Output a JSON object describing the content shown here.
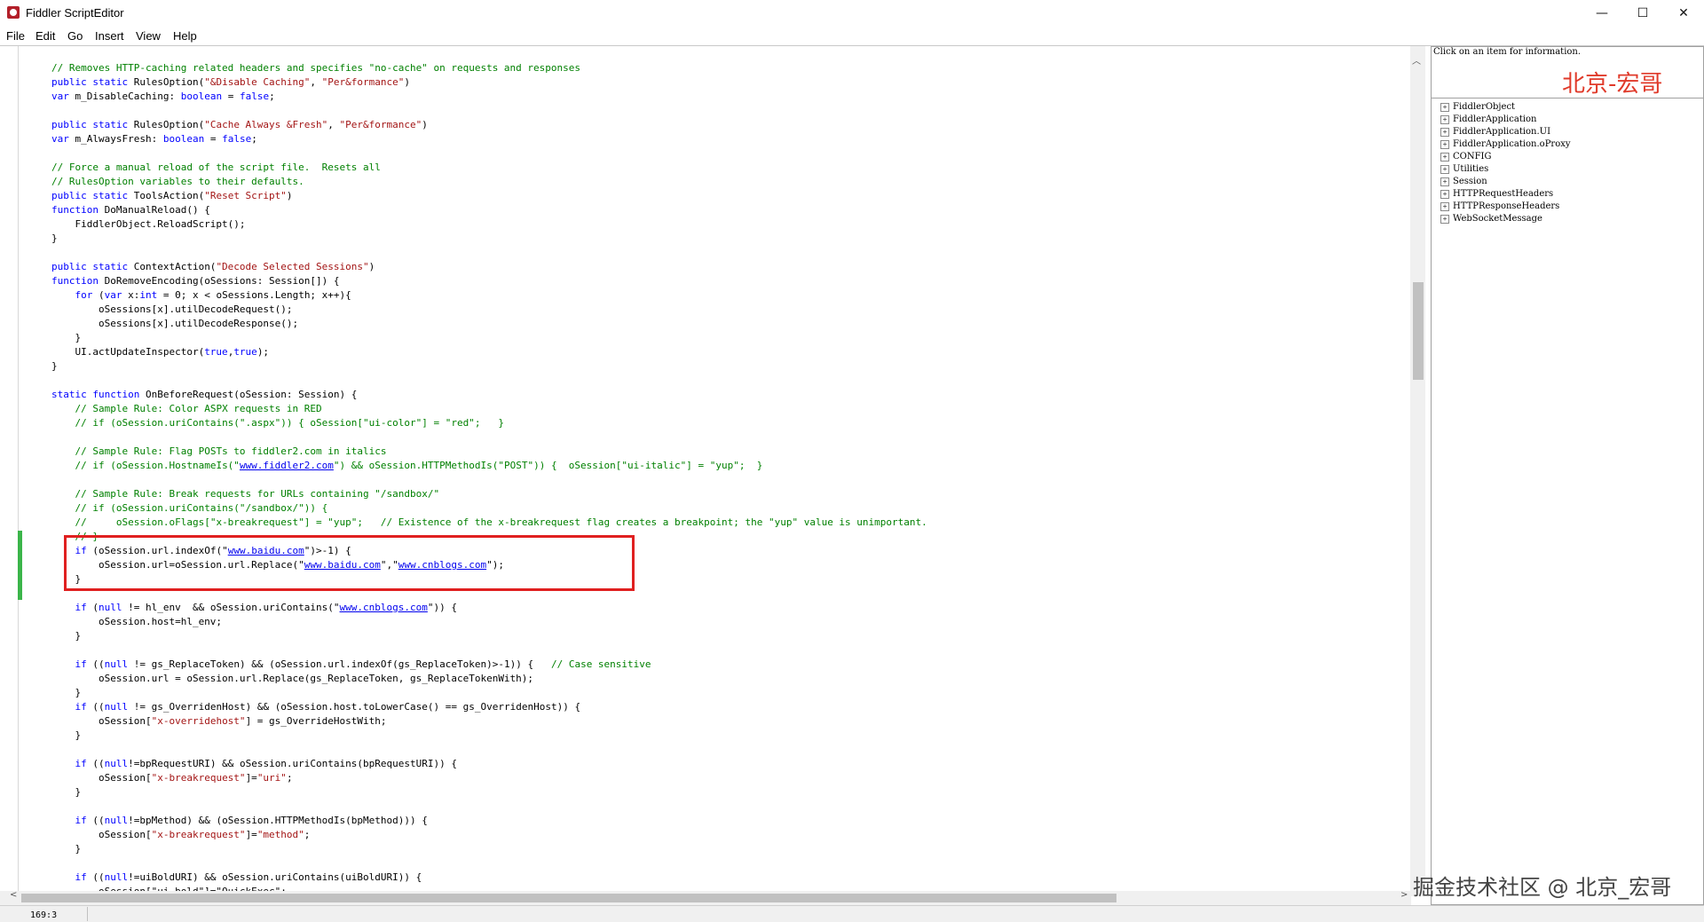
{
  "window": {
    "title": "Fiddler ScriptEditor",
    "min_glyph": "—",
    "max_glyph": "☐",
    "close_glyph": "✕"
  },
  "menu": [
    "File",
    "Edit",
    "Go",
    "Insert",
    "View",
    "Help"
  ],
  "code_lines": [
    [
      [
        "cm",
        "// Removes HTTP-caching related headers and specifies \"no-cache\" on requests and responses"
      ]
    ],
    [
      [
        "kw",
        "public static "
      ],
      [
        "t",
        "RulesOption("
      ],
      [
        "st",
        "\"&Disable Caching\""
      ],
      [
        "t",
        ", "
      ],
      [
        "st",
        "\"Per&formance\""
      ],
      [
        "t",
        ")"
      ]
    ],
    [
      [
        "kw",
        "var "
      ],
      [
        "t",
        "m_DisableCaching: "
      ],
      [
        "kw",
        "boolean"
      ],
      [
        "t",
        " = "
      ],
      [
        "kw",
        "false"
      ],
      [
        "t",
        ";"
      ]
    ],
    [],
    [
      [
        "kw",
        "public static "
      ],
      [
        "t",
        "RulesOption("
      ],
      [
        "st",
        "\"Cache Always &Fresh\""
      ],
      [
        "t",
        ", "
      ],
      [
        "st",
        "\"Per&formance\""
      ],
      [
        "t",
        ")"
      ]
    ],
    [
      [
        "kw",
        "var "
      ],
      [
        "t",
        "m_AlwaysFresh: "
      ],
      [
        "kw",
        "boolean"
      ],
      [
        "t",
        " = "
      ],
      [
        "kw",
        "false"
      ],
      [
        "t",
        ";"
      ]
    ],
    [],
    [
      [
        "cm",
        "// Force a manual reload of the script file.  Resets all"
      ]
    ],
    [
      [
        "cm",
        "// RulesOption variables to their defaults."
      ]
    ],
    [
      [
        "kw",
        "public static "
      ],
      [
        "t",
        "ToolsAction("
      ],
      [
        "st",
        "\"Reset Script\""
      ],
      [
        "t",
        ")"
      ]
    ],
    [
      [
        "kw",
        "function "
      ],
      [
        "t",
        "DoManualReload() {"
      ]
    ],
    [
      [
        "t",
        "    FiddlerObject.ReloadScript();"
      ]
    ],
    [
      [
        "t",
        "}"
      ]
    ],
    [],
    [
      [
        "kw",
        "public static "
      ],
      [
        "t",
        "ContextAction("
      ],
      [
        "st",
        "\"Decode Selected Sessions\""
      ],
      [
        "t",
        ")"
      ]
    ],
    [
      [
        "kw",
        "function "
      ],
      [
        "t",
        "DoRemoveEncoding(oSessions: Session[]) {"
      ]
    ],
    [
      [
        "t",
        "    "
      ],
      [
        "kw",
        "for "
      ],
      [
        "t",
        "("
      ],
      [
        "kw",
        "var "
      ],
      [
        "t",
        "x:"
      ],
      [
        "kw",
        "int"
      ],
      [
        "t",
        " = 0; x < oSessions.Length; x++){"
      ]
    ],
    [
      [
        "t",
        "        oSessions[x].utilDecodeRequest();"
      ]
    ],
    [
      [
        "t",
        "        oSessions[x].utilDecodeResponse();"
      ]
    ],
    [
      [
        "t",
        "    }"
      ]
    ],
    [
      [
        "t",
        "    UI.actUpdateInspector("
      ],
      [
        "kw",
        "true"
      ],
      [
        "t",
        ","
      ],
      [
        "kw",
        "true"
      ],
      [
        "t",
        ");"
      ]
    ],
    [
      [
        "t",
        "}"
      ]
    ],
    [],
    [
      [
        "kw",
        "static function "
      ],
      [
        "t",
        "OnBeforeRequest(oSession: Session) {"
      ]
    ],
    [
      [
        "t",
        "    "
      ],
      [
        "cm",
        "// Sample Rule: Color ASPX requests in RED"
      ]
    ],
    [
      [
        "t",
        "    "
      ],
      [
        "cm",
        "// if (oSession.uriContains(\".aspx\")) { oSession[\"ui-color\"] = \"red\";   }"
      ]
    ],
    [],
    [
      [
        "t",
        "    "
      ],
      [
        "cm",
        "// Sample Rule: Flag POSTs to fiddler2.com in italics"
      ]
    ],
    [
      [
        "t",
        "    "
      ],
      [
        "cm",
        "// if (oSession.HostnameIs(\""
      ],
      [
        "url",
        "www.fiddler2.com"
      ],
      [
        "cm",
        "\") && oSession.HTTPMethodIs(\"POST\")) {  oSession[\"ui-italic\"] = \"yup\";  }"
      ]
    ],
    [],
    [
      [
        "t",
        "    "
      ],
      [
        "cm",
        "// Sample Rule: Break requests for URLs containing \"/sandbox/\""
      ]
    ],
    [
      [
        "t",
        "    "
      ],
      [
        "cm",
        "// if (oSession.uriContains(\"/sandbox/\")) {"
      ]
    ],
    [
      [
        "t",
        "    "
      ],
      [
        "cm",
        "//     oSession.oFlags[\"x-breakrequest\"] = \"yup\";   // Existence of the x-breakrequest flag creates a breakpoint; the \"yup\" value is unimportant."
      ]
    ],
    [
      [
        "t",
        "    "
      ],
      [
        "cm",
        "// }"
      ]
    ],
    [
      [
        "t",
        "    "
      ],
      [
        "kw",
        "if "
      ],
      [
        "t",
        "(oSession.url.indexOf(\""
      ],
      [
        "url",
        "www.baidu.com"
      ],
      [
        "t",
        "\")>-1) {"
      ]
    ],
    [
      [
        "t",
        "        oSession.url=oSession.url.Replace(\""
      ],
      [
        "url",
        "www.baidu.com"
      ],
      [
        "t",
        "\",\""
      ],
      [
        "url",
        "www.cnblogs.com"
      ],
      [
        "t",
        "\");"
      ]
    ],
    [
      [
        "t",
        "    }"
      ]
    ],
    [],
    [
      [
        "t",
        "    "
      ],
      [
        "kw",
        "if "
      ],
      [
        "t",
        "("
      ],
      [
        "kw",
        "null"
      ],
      [
        "t",
        " != hl_env  && oSession.uriContains(\""
      ],
      [
        "url",
        "www.cnblogs.com"
      ],
      [
        "t",
        "\")) {"
      ]
    ],
    [
      [
        "t",
        "        oSession.host=hl_env;"
      ]
    ],
    [
      [
        "t",
        "    }"
      ]
    ],
    [],
    [
      [
        "t",
        "    "
      ],
      [
        "kw",
        "if "
      ],
      [
        "t",
        "(("
      ],
      [
        "kw",
        "null"
      ],
      [
        "t",
        " != gs_ReplaceToken) && (oSession.url.indexOf(gs_ReplaceToken)>-1)) {   "
      ],
      [
        "cm",
        "// Case sensitive"
      ]
    ],
    [
      [
        "t",
        "        oSession.url = oSession.url.Replace(gs_ReplaceToken, gs_ReplaceTokenWith);"
      ]
    ],
    [
      [
        "t",
        "    }"
      ]
    ],
    [
      [
        "t",
        "    "
      ],
      [
        "kw",
        "if "
      ],
      [
        "t",
        "(("
      ],
      [
        "kw",
        "null"
      ],
      [
        "t",
        " != gs_OverridenHost) && (oSession.host.toLowerCase() == gs_OverridenHost)) {"
      ]
    ],
    [
      [
        "t",
        "        oSession["
      ],
      [
        "st",
        "\"x-overridehost\""
      ],
      [
        "t",
        "] = gs_OverrideHostWith;"
      ]
    ],
    [
      [
        "t",
        "    }"
      ]
    ],
    [],
    [
      [
        "t",
        "    "
      ],
      [
        "kw",
        "if "
      ],
      [
        "t",
        "(("
      ],
      [
        "kw",
        "null"
      ],
      [
        "t",
        "!=bpRequestURI) && oSession.uriContains(bpRequestURI)) {"
      ]
    ],
    [
      [
        "t",
        "        oSession["
      ],
      [
        "st",
        "\"x-breakrequest\""
      ],
      [
        "t",
        "]="
      ],
      [
        "st",
        "\"uri\""
      ],
      [
        "t",
        ";"
      ]
    ],
    [
      [
        "t",
        "    }"
      ]
    ],
    [],
    [
      [
        "t",
        "    "
      ],
      [
        "kw",
        "if "
      ],
      [
        "t",
        "(("
      ],
      [
        "kw",
        "null"
      ],
      [
        "t",
        "!=bpMethod) && (oSession.HTTPMethodIs(bpMethod))) {"
      ]
    ],
    [
      [
        "t",
        "        oSession["
      ],
      [
        "st",
        "\"x-breakrequest\""
      ],
      [
        "t",
        "]="
      ],
      [
        "st",
        "\"method\""
      ],
      [
        "t",
        ";"
      ]
    ],
    [
      [
        "t",
        "    }"
      ]
    ],
    [],
    [
      [
        "t",
        "    "
      ],
      [
        "kw",
        "if "
      ],
      [
        "t",
        "(("
      ],
      [
        "kw",
        "null"
      ],
      [
        "t",
        "!=uiBoldURI) && oSession.uriContains(uiBoldURI)) {"
      ]
    ],
    [
      [
        "t",
        "        oSession[\"ui-bold\"]=\"QuickExec\";"
      ]
    ]
  ],
  "info_panel": {
    "text": "Click on an item for information.",
    "watermark": "北京-宏哥"
  },
  "tree": [
    "FiddlerObject",
    "FiddlerApplication",
    "FiddlerApplication.UI",
    "FiddlerApplication.oProxy",
    "CONFIG",
    "Utilities",
    "Session",
    "HTTPRequestHeaders",
    "HTTPResponseHeaders",
    "WebSocketMessage"
  ],
  "tree_expander": "+",
  "status": {
    "position": "169:3"
  },
  "scroll_glyphs": {
    "up": "︿",
    "left": "<",
    "right": ">"
  },
  "watermark_bottom": "掘金技术社区 @ 北京_宏哥"
}
